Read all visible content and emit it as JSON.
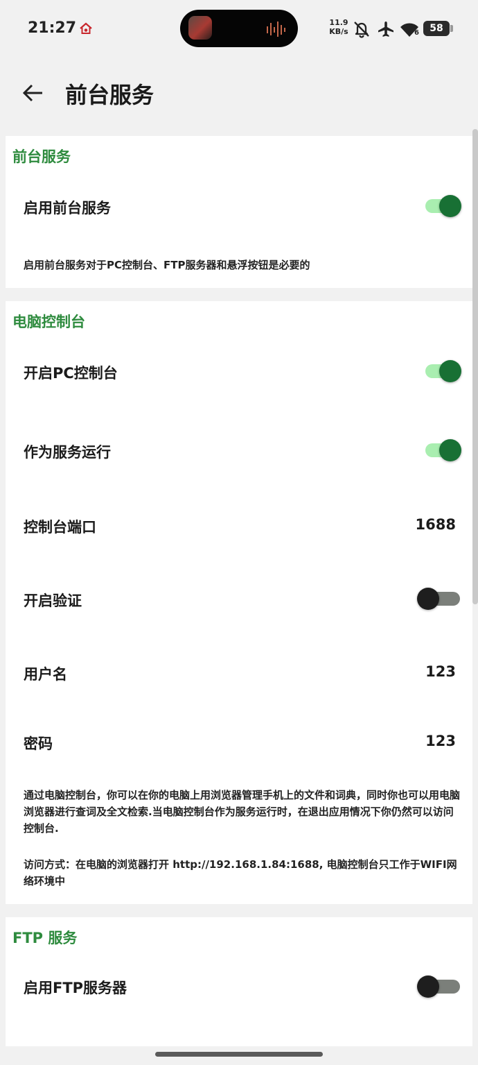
{
  "status_bar": {
    "time": "21:27",
    "net_speed_value": "11.9",
    "net_speed_unit": "KB/s",
    "battery": "58",
    "wifi_sub": "6",
    "icons": [
      "home-alert-icon",
      "bell-off-icon",
      "airplane-icon",
      "wifi-icon",
      "battery-icon"
    ]
  },
  "header": {
    "title": "前台服务"
  },
  "sections": {
    "foreground": {
      "title": "前台服务",
      "enable_label": "启用前台服务",
      "enable_on": true,
      "desc": "启用前台服务对于PC控制台、FTP服务器和悬浮按钮是必要的"
    },
    "pc_console": {
      "title": "电脑控制台",
      "enable_label": "开启PC控制台",
      "enable_on": true,
      "service_label": "作为服务运行",
      "service_on": true,
      "port_label": "控制台端口",
      "port_value": "1688",
      "auth_label": "开启验证",
      "auth_on": false,
      "username_label": "用户名",
      "username_value": "123",
      "password_label": "密码",
      "password_value": "123",
      "desc1": "通过电脑控制台，你可以在你的电脑上用浏览器管理手机上的文件和词典，同时你也可以用电脑浏览器进行查词及全文检索.当电脑控制台作为服务运行时，在退出应用情况下你仍然可以访问控制台.",
      "desc2": "访问方式：在电脑的浏览器打开 http://192.168.1.84:1688, 电脑控制台只工作于WIFI网络环境中"
    },
    "ftp": {
      "title": "FTP 服务",
      "enable_label": "启用FTP服务器",
      "enable_on": false
    }
  },
  "colors": {
    "accent_green": "#2e8b3e",
    "switch_on_knob": "#187034",
    "switch_on_track": "#a9eeb0",
    "switch_off_knob": "#1e1e1e",
    "switch_off_track": "#7b7f7a",
    "background": "#f1f1f1",
    "card": "#ffffff"
  }
}
